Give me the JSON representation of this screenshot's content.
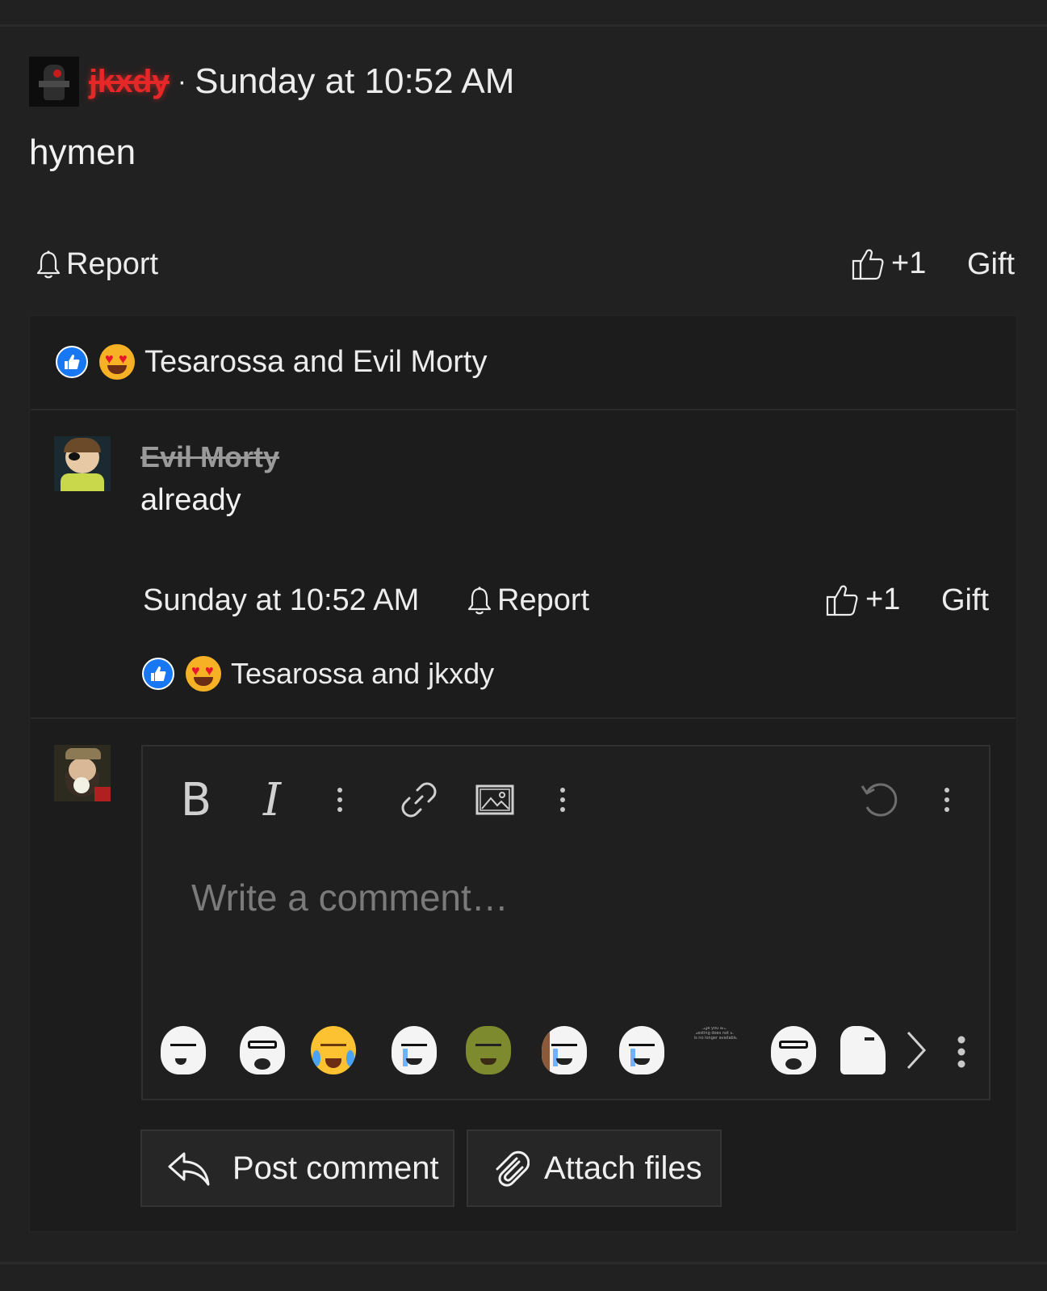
{
  "post": {
    "author": "jkxdy",
    "separator": "·",
    "time": "Sunday at 10:52 AM",
    "body": "hymen",
    "actions": {
      "report": "Report",
      "plus_one": "+1",
      "gift": "Gift"
    },
    "reactions_text": "Tesarossa and Evil Morty"
  },
  "comment": {
    "author": "Evil Morty",
    "body": "already",
    "time": "Sunday at 10:52 AM",
    "actions": {
      "report": "Report",
      "plus_one": "+1",
      "gift": "Gift"
    },
    "reactions_text": "Tesarossa and jkxdy"
  },
  "composer": {
    "placeholder": "Write a comment…",
    "toolbar": {
      "bold": "B",
      "italic": "I"
    },
    "emojis": [
      "smirk-wojak",
      "soyjak-glasses",
      "tears-of-joy",
      "crying-wojak",
      "shrek",
      "crying-wojak-2",
      "crying-wojak-3",
      "broken-image",
      "soyjak-glasses-2",
      "wojak-side"
    ],
    "broken_image_text": "The image you are requesting does not exist or is no longer available",
    "post_button": "Post comment",
    "attach_button": "Attach files"
  },
  "colors": {
    "background": "#212121",
    "panel": "#1c1c1c",
    "op_name": "#e62727",
    "like_blue": "#1877f2",
    "text": "#ececec",
    "muted": "#7a7a7a"
  }
}
